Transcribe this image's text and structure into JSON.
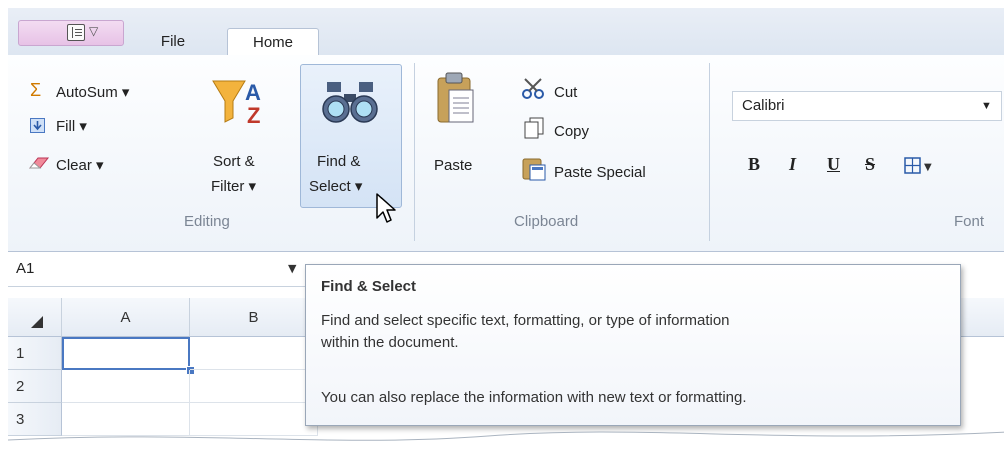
{
  "tabs": {
    "file": "File",
    "home": "Home"
  },
  "ribbon": {
    "editing": {
      "autosum": "AutoSum",
      "fill": "Fill",
      "clear": "Clear",
      "sort_line1": "Sort &",
      "sort_line2": "Filter",
      "find_line1": "Find &",
      "find_line2": "Select",
      "group_label": "Editing"
    },
    "clipboard": {
      "paste": "Paste",
      "cut": "Cut",
      "copy": "Copy",
      "paste_special": "Paste Special",
      "group_label": "Clipboard"
    },
    "font": {
      "font_name": "Calibri",
      "bold": "B",
      "italic": "I",
      "underline": "U",
      "strike": "S",
      "group_label": "Font"
    }
  },
  "formula_bar": {
    "name_box": "A1"
  },
  "grid": {
    "columns": [
      "A",
      "B"
    ],
    "rows": [
      "1",
      "2",
      "3"
    ]
  },
  "tooltip": {
    "title": "Find & Select",
    "line1": "Find and select specific text, formatting, or type of information",
    "line2": "within the document.",
    "line3": "You can also replace the information with new text or formatting."
  },
  "colors": {
    "accent": "#4a78c2",
    "tab_border": "#b6c3d6",
    "selection": "#9fb8d8"
  }
}
